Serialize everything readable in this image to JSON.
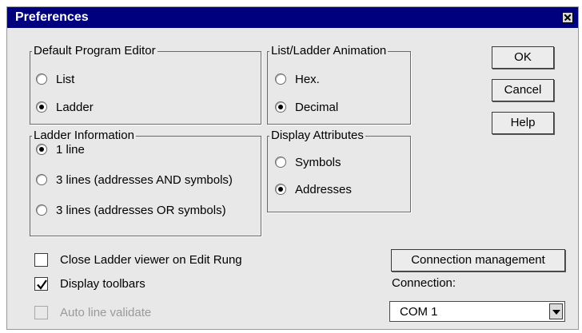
{
  "window": {
    "title": "Preferences"
  },
  "groups": {
    "default_editor": {
      "legend": "Default Program Editor",
      "options": [
        "List",
        "Ladder"
      ],
      "selected": "Ladder"
    },
    "animation": {
      "legend": "List/Ladder Animation",
      "options": [
        "Hex.",
        "Decimal"
      ],
      "selected": "Decimal"
    },
    "ladder_info": {
      "legend": "Ladder Information",
      "options": [
        "1 line",
        "3 lines (addresses AND symbols)",
        "3 lines (addresses OR symbols)"
      ],
      "selected": "1 line"
    },
    "display_attributes": {
      "legend": "Display Attributes",
      "options": [
        "Symbols",
        "Addresses"
      ],
      "selected": "Addresses"
    }
  },
  "buttons": {
    "ok": "OK",
    "cancel": "Cancel",
    "help": "Help",
    "connection_management": "Connection management"
  },
  "checkboxes": [
    {
      "label": "Close Ladder viewer on Edit Rung",
      "checked": false,
      "enabled": true
    },
    {
      "label": "Display toolbars",
      "checked": true,
      "enabled": true
    },
    {
      "label": "Auto line validate",
      "checked": false,
      "enabled": false
    }
  ],
  "connection": {
    "label": "Connection:",
    "value": "COM 1"
  }
}
